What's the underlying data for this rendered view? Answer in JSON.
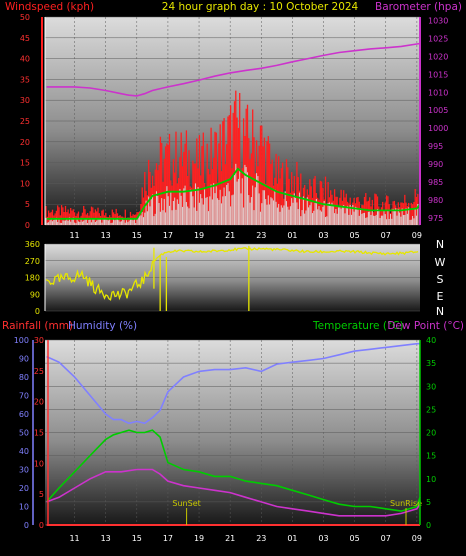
{
  "header": {
    "title": "24 hour graph day : 10 October 2024",
    "left_label": "Windspeed (kph)",
    "right_label": "Barometer (hpa)"
  },
  "lower_header": {
    "rainfall_label": "Rainfall (mm)",
    "humidity_label": "Humidity (%)",
    "temperature_label": "Temperature (°C)",
    "dewpoint_label": "Dew Point (°C)"
  },
  "colors": {
    "wind": "#ff2020",
    "gust": "#dddddd",
    "wind_avg": "#00cc00",
    "barometer": "#cc33cc",
    "wind_dir": "#e6e600",
    "rain": "#ff3030",
    "humidity": "#8080ff",
    "temperature": "#00cc00",
    "dewpoint": "#cc33cc",
    "sun": "#c8c800"
  },
  "chart_data": [
    {
      "type": "line",
      "name": "wind-baro",
      "x_tick_labels": [
        "11",
        "13",
        "15",
        "17",
        "19",
        "21",
        "23",
        "01",
        "03",
        "05",
        "07",
        "09"
      ],
      "x_ticks_hours": [
        11,
        13,
        15,
        17,
        19,
        21,
        23,
        25,
        27,
        29,
        31,
        33
      ],
      "x_range_hours": [
        9.1,
        33.2
      ],
      "left_axis": {
        "label": "Windspeed (kph)",
        "range": [
          0,
          50
        ],
        "ticks": [
          0,
          5,
          10,
          15,
          20,
          25,
          30,
          35,
          40,
          45,
          50
        ]
      },
      "right_axis": {
        "label": "Barometer (hpa)",
        "range": [
          973,
          1031
        ],
        "ticks": [
          975,
          980,
          985,
          990,
          995,
          1000,
          1005,
          1010,
          1015,
          1020,
          1025,
          1030
        ]
      },
      "series": [
        {
          "name": "Barometer",
          "axis": "right",
          "x": [
            9.2,
            11,
            12,
            13,
            14,
            14.5,
            15,
            15.5,
            16,
            17,
            18,
            19,
            20,
            21,
            22,
            23,
            24,
            25,
            26,
            27,
            28,
            29,
            30,
            31,
            32,
            33.2
          ],
          "y": [
            1011.5,
            1011.5,
            1011.2,
            1010.5,
            1009.6,
            1009.2,
            1009.0,
            1009.6,
            1010.5,
            1011.5,
            1012.4,
            1013.4,
            1014.5,
            1015.4,
            1016.1,
            1016.7,
            1017.5,
            1018.5,
            1019.4,
            1020.3,
            1021.1,
            1021.6,
            1022.1,
            1022.4,
            1022.8,
            1023.6
          ]
        },
        {
          "name": "Wind average",
          "axis": "left",
          "x": [
            9.2,
            11,
            13,
            15,
            15.5,
            16,
            17,
            18,
            19,
            20,
            21,
            21.5,
            22,
            23,
            24,
            25,
            26,
            27,
            28,
            29,
            30,
            31,
            32,
            33,
            33.2
          ],
          "y": [
            1.5,
            1.5,
            1.5,
            1.5,
            4.5,
            7.0,
            8.0,
            8.0,
            8.5,
            9.5,
            11.0,
            13.5,
            12.0,
            10.0,
            8.0,
            7.0,
            6.0,
            5.0,
            4.5,
            4.0,
            3.5,
            3.5,
            3.5,
            4.0,
            5.0
          ]
        },
        {
          "name": "Wind gust (bars)",
          "axis": "left",
          "x": [
            9.2,
            11,
            13,
            15,
            15.5,
            16,
            17,
            18,
            19,
            20,
            21,
            21.5,
            22,
            23,
            24,
            25,
            26,
            27,
            28,
            29,
            30,
            31,
            32,
            33,
            33.2
          ],
          "y": [
            4.0,
            4.0,
            3.5,
            3.5,
            13.0,
            18.0,
            19.0,
            20.0,
            18.0,
            21.0,
            26.0,
            29.0,
            25.0,
            24.0,
            14.0,
            14.0,
            10.0,
            10.0,
            8.0,
            7.0,
            6.5,
            6.0,
            6.5,
            8.0,
            17.0
          ]
        }
      ]
    },
    {
      "type": "scatter",
      "name": "wind-direction",
      "x_range_hours": [
        9.1,
        33.2
      ],
      "left_axis": {
        "range": [
          0,
          360
        ],
        "ticks": [
          0,
          90,
          180,
          270,
          360
        ],
        "tick_labels": [
          "0",
          "90",
          "180",
          "270",
          "360"
        ]
      },
      "right_axis_letters": [
        "N",
        "W",
        "S",
        "E",
        "N"
      ],
      "series": [
        {
          "name": "Wind direction",
          "x": [
            9.2,
            10,
            11,
            11.5,
            12,
            12.5,
            13,
            13.5,
            14,
            14.5,
            15,
            15.5,
            16,
            16.5,
            17,
            18,
            19,
            20,
            21,
            22,
            23,
            24,
            25,
            26,
            27,
            28,
            29,
            30,
            31,
            32,
            33,
            33.2
          ],
          "y": [
            160,
            165,
            185,
            195,
            150,
            110,
            95,
            90,
            85,
            105,
            140,
            170,
            260,
            300,
            320,
            322,
            318,
            322,
            330,
            333,
            335,
            330,
            325,
            318,
            318,
            320,
            318,
            312,
            308,
            310,
            318,
            330
          ]
        }
      ],
      "markers": [
        {
          "x": 16.1,
          "y_from": 120,
          "y_to": 340
        },
        {
          "x": 16.5,
          "y_from": 0,
          "y_to": 300
        },
        {
          "x": 16.9,
          "y_from": 0,
          "y_to": 290
        },
        {
          "x": 22.2,
          "y_from": 0,
          "y_to": 350
        }
      ]
    },
    {
      "type": "line",
      "name": "temp-humidity",
      "x_tick_labels": [
        "11",
        "13",
        "15",
        "17",
        "19",
        "21",
        "23",
        "01",
        "03",
        "05",
        "07",
        "09"
      ],
      "x_ticks_hours": [
        11,
        13,
        15,
        17,
        19,
        21,
        23,
        25,
        27,
        29,
        31,
        33
      ],
      "x_range_hours": [
        9.1,
        33.2
      ],
      "rain_axis": {
        "label": "Rainfall (mm)",
        "range": [
          0,
          30
        ],
        "ticks": [
          0,
          5,
          10,
          15,
          20,
          25,
          30
        ]
      },
      "humidity_axis": {
        "label": "Humidity (%)",
        "range": [
          0,
          100
        ],
        "ticks": [
          0,
          10,
          20,
          30,
          40,
          50,
          60,
          70,
          80,
          90,
          100
        ]
      },
      "temperature_axis": {
        "label": "Temperature (°C)",
        "range": [
          0,
          40
        ],
        "ticks": [
          0,
          5,
          10,
          15,
          20,
          25,
          30,
          35,
          40
        ]
      },
      "series": [
        {
          "name": "Humidity",
          "axis": "humidity",
          "x": [
            9.2,
            10,
            11,
            12,
            13,
            13.5,
            14,
            14.5,
            15,
            15.5,
            16,
            16.5,
            17,
            18,
            19,
            20,
            21,
            22,
            23,
            24,
            25,
            26,
            27,
            28,
            29,
            30,
            31,
            32,
            33,
            33.2
          ],
          "y": [
            91,
            88,
            80,
            70,
            60,
            57,
            57,
            55,
            56,
            55,
            58,
            62,
            72,
            80,
            83,
            84,
            84,
            85,
            83,
            87,
            88,
            89,
            90,
            92,
            94,
            95,
            96,
            97,
            98,
            98
          ]
        },
        {
          "name": "Temperature",
          "axis": "temperature",
          "x": [
            9.2,
            10,
            11,
            12,
            13,
            13.5,
            14,
            14.5,
            15,
            15.5,
            16,
            16.5,
            17,
            18,
            19,
            20,
            21,
            22,
            23,
            24,
            25,
            26,
            27,
            28,
            29,
            30,
            31,
            32,
            33,
            33.2
          ],
          "y": [
            5.0,
            8.0,
            11.5,
            15.0,
            18.5,
            19.5,
            20.0,
            20.5,
            20.0,
            20.0,
            20.5,
            19.0,
            13.5,
            12.0,
            11.5,
            10.5,
            10.5,
            9.5,
            9.0,
            8.5,
            7.5,
            6.5,
            5.5,
            4.5,
            4.0,
            4.0,
            3.5,
            3.0,
            4.0,
            6.0
          ]
        },
        {
          "name": "Dew Point",
          "axis": "temperature",
          "x": [
            9.2,
            10,
            11,
            12,
            13,
            14,
            15,
            16,
            16.5,
            17,
            18,
            19,
            20,
            21,
            22,
            23,
            24,
            25,
            26,
            27,
            28,
            29,
            30,
            31,
            32,
            33,
            33.2
          ],
          "y": [
            5.0,
            6.0,
            8.0,
            10.0,
            11.5,
            11.5,
            12.0,
            12.0,
            11.0,
            9.5,
            8.5,
            8.0,
            7.5,
            7.0,
            6.0,
            5.0,
            4.0,
            3.5,
            3.0,
            2.5,
            2.0,
            2.0,
            2.0,
            2.0,
            2.5,
            3.5,
            4.5
          ]
        },
        {
          "name": "Rainfall",
          "axis": "rain",
          "x": [
            9.2,
            33.2
          ],
          "y": [
            0,
            0
          ]
        }
      ],
      "events": [
        {
          "label": "SunSet",
          "x": 18.2
        },
        {
          "label": "SunRise",
          "x": 32.3
        }
      ]
    }
  ]
}
